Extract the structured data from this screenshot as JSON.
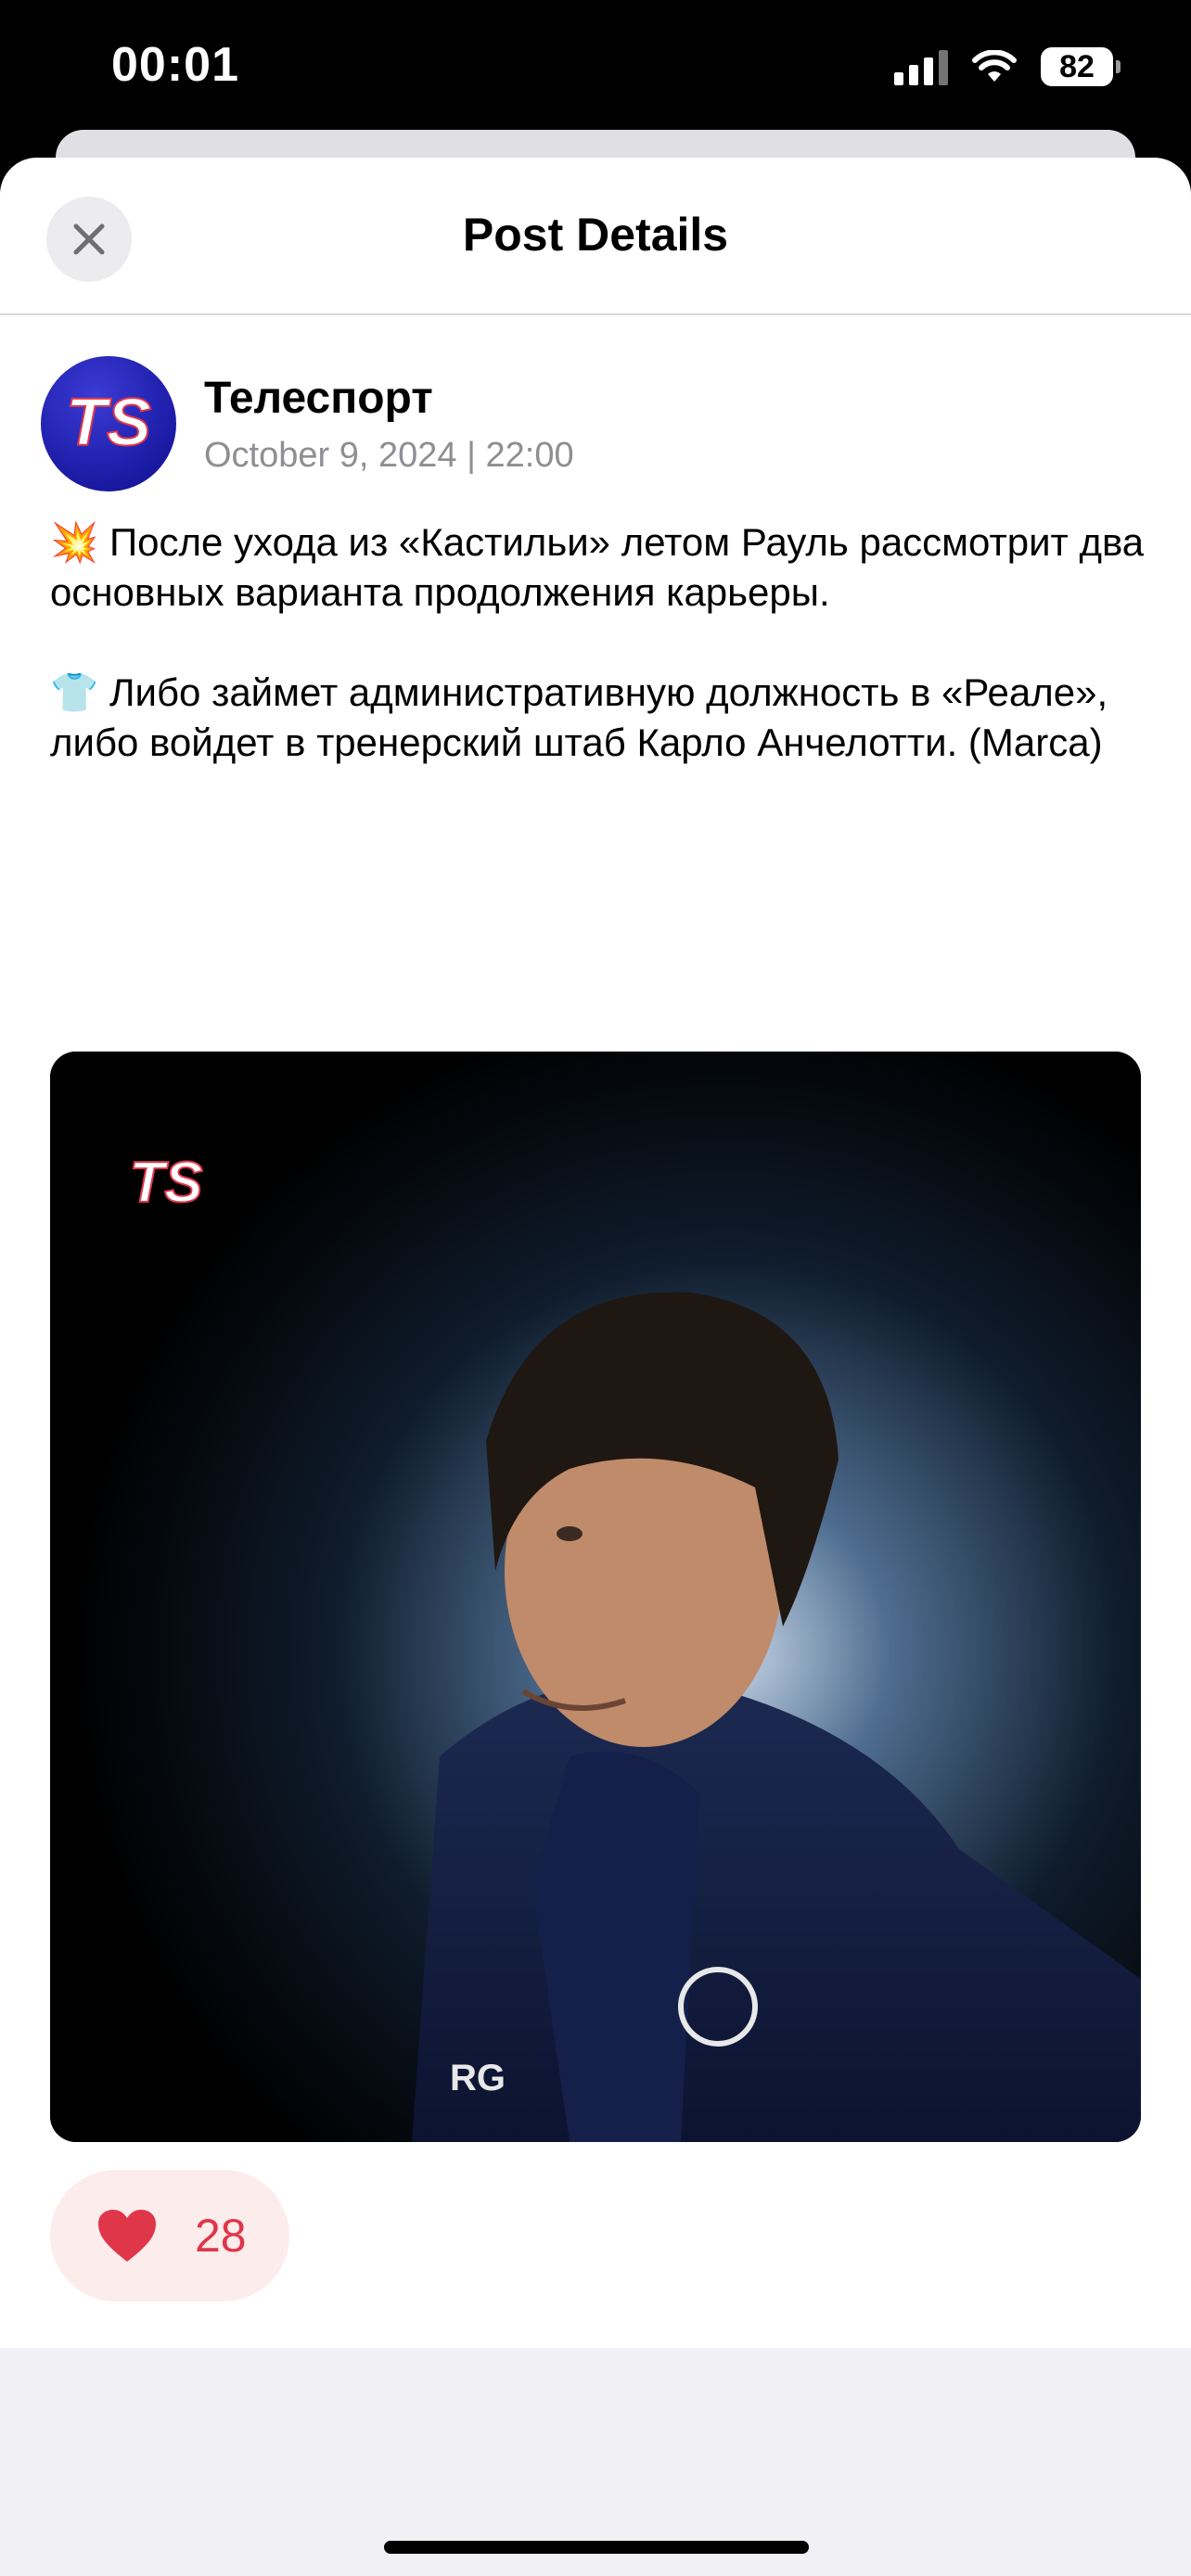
{
  "status_bar": {
    "time": "00:01",
    "battery": "82",
    "icons": [
      "cellular-signal-icon",
      "wifi-icon",
      "battery-icon"
    ]
  },
  "nav": {
    "title": "Post Details",
    "close_icon": "close-icon"
  },
  "post": {
    "channel_name": "Телеспорт",
    "avatar_logo_text": "TS",
    "date": "October 9, 2024 | 22:00",
    "text": "💥 После ухода из «Кастильи» летом Рауль рассмотрит два основных варианта продолжения карьеры.\n\n👕 Либо займет административную должность в «Реале», либо войдет в тренерский штаб Карло Анчелотти. (Marca)",
    "image": {
      "watermark": "TS",
      "shirt_initials": "RG"
    },
    "likes": {
      "icon": "heart-icon",
      "count": "28"
    }
  },
  "colors": {
    "accent_red": "#e0364a",
    "like_bg": "#fdecec",
    "date_gray": "#8e8e93",
    "sheet_bg": "#f0f0f5"
  }
}
